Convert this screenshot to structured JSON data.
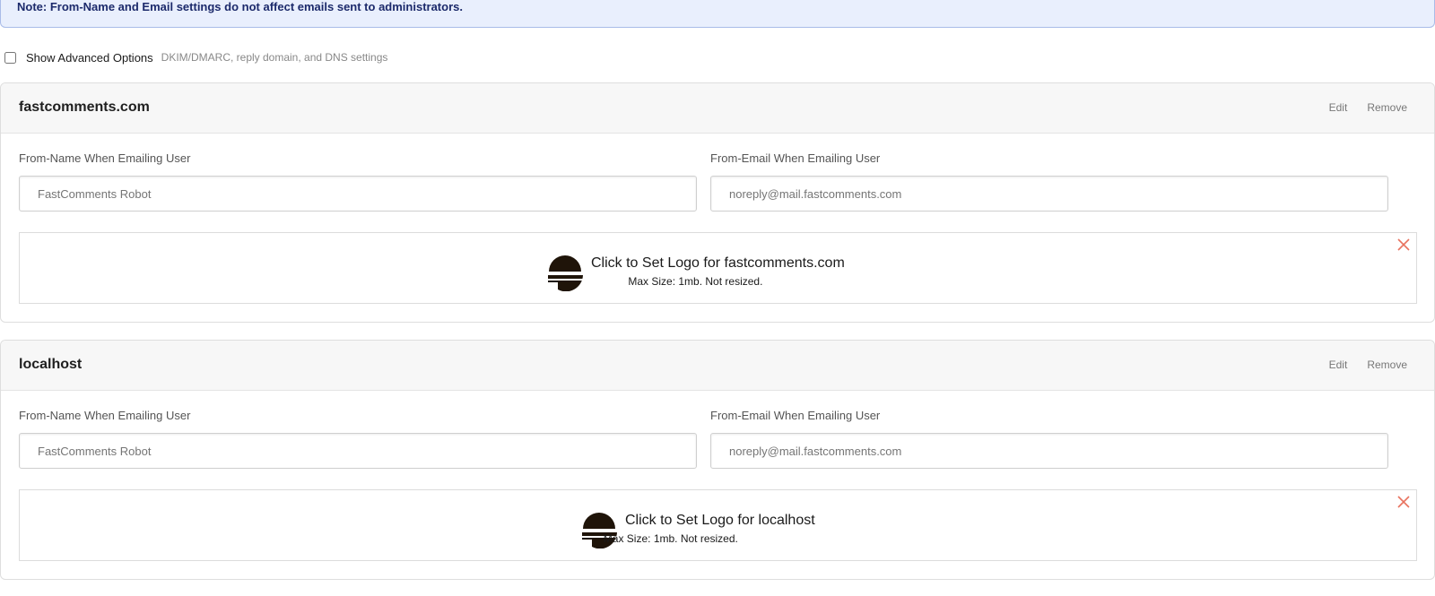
{
  "note": {
    "text": "Note: From-Name and Email settings do not affect emails sent to administrators."
  },
  "advanced": {
    "label": "Show Advanced Options",
    "hint": "DKIM/DMARC, reply domain, and DNS settings",
    "checked": false
  },
  "domains": [
    {
      "name": "fastcomments.com",
      "edit_label": "Edit",
      "remove_label": "Remove",
      "from_name_label": "From-Name When Emailing User",
      "from_name_placeholder": "FastComments Robot",
      "from_email_label": "From-Email When Emailing User",
      "from_email_placeholder": "noreply@mail.fastcomments.com",
      "logo_title": "Click to Set Logo for fastcomments.com",
      "logo_sub": "Max Size: 1mb. Not resized."
    },
    {
      "name": "localhost",
      "edit_label": "Edit",
      "remove_label": "Remove",
      "from_name_label": "From-Name When Emailing User",
      "from_name_placeholder": "FastComments Robot",
      "from_email_label": "From-Email When Emailing User",
      "from_email_placeholder": "noreply@mail.fastcomments.com",
      "logo_title": "Click to Set Logo for localhost",
      "logo_sub": "Max Size: 1mb. Not resized."
    }
  ],
  "colors": {
    "close_icon": "#e8735f",
    "note_bg": "#e9effd",
    "note_text": "#1c2a6b"
  },
  "icons": {
    "logo_mark": "fastcomments-logo-icon",
    "close": "close-icon"
  }
}
